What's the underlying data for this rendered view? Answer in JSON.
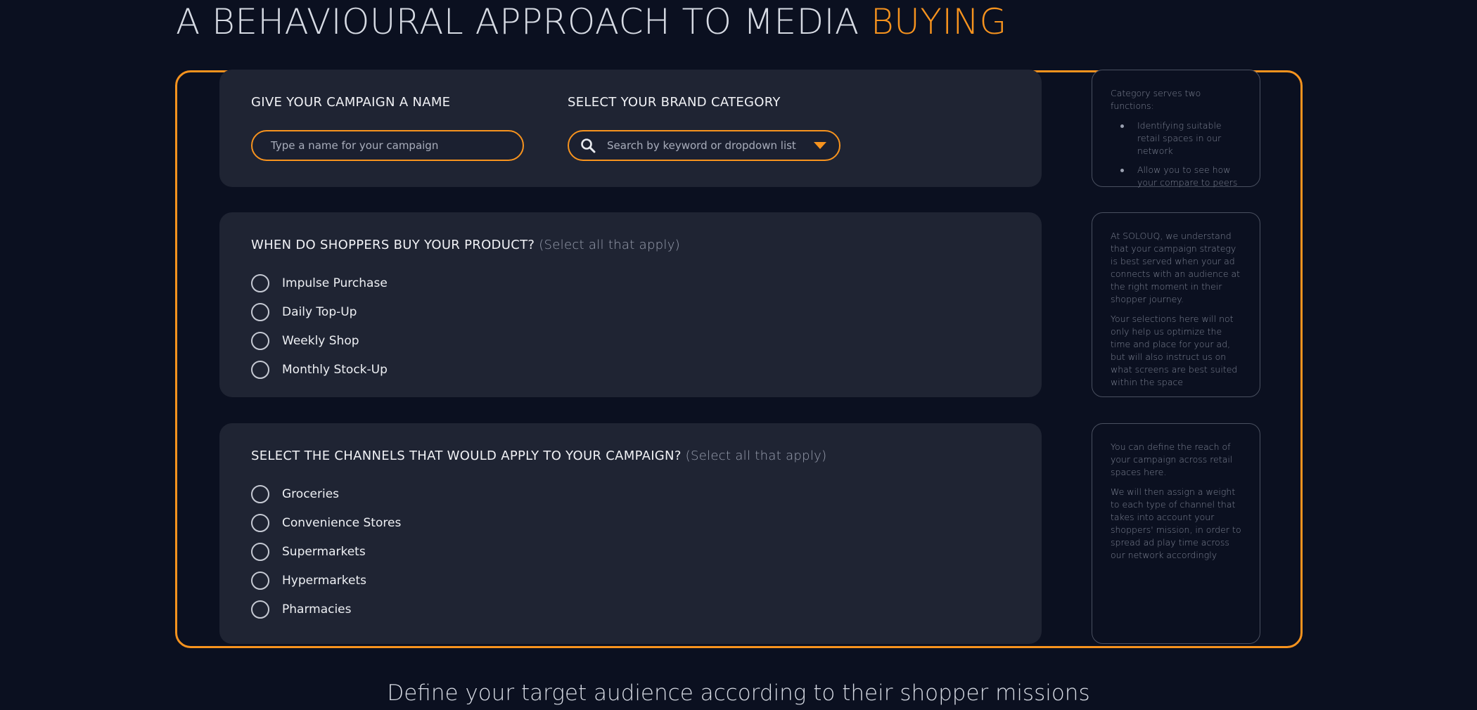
{
  "header": {
    "title_main": "A BEHAVIOURAL APPROACH TO MEDIA ",
    "title_accent": "BUYING"
  },
  "campaign": {
    "name_label": "GIVE YOUR CAMPAIGN A NAME",
    "name_placeholder": "Type a name for your campaign",
    "category_label": "SELECT YOUR BRAND CATEGORY",
    "category_placeholder": "Search by keyword or dropdown list"
  },
  "category_info": {
    "intro": "Category serves two functions:",
    "bullets": [
      "Identifying suitable retail spaces in our network",
      "Allow you to see how your compare to peers"
    ]
  },
  "when_section": {
    "question": "WHEN DO SHOPPERS BUY YOUR PRODUCT?",
    "hint": "(Select all that apply)",
    "options": [
      "Impulse Purchase",
      "Daily Top-Up",
      "Weekly Shop",
      "Monthly Stock-Up"
    ]
  },
  "when_info": {
    "p1": "At SOLOUQ, we understand that your campaign strategy is best served when your ad connects with an audience at the right moment in their shopper journey.",
    "p2": "Your selections here will not only help us optimize the time and place for your ad, but will also instruct us on what screens are best suited within the space"
  },
  "channels_section": {
    "question": "SELECT THE CHANNELS THAT WOULD APPLY TO YOUR CAMPAIGN?",
    "hint": "(Select all that apply)",
    "options": [
      "Groceries",
      "Convenience Stores",
      "Supermarkets",
      "Hypermarkets",
      "Pharmacies"
    ]
  },
  "channels_info": {
    "p1": "You can define the reach of your campaign across retail spaces here.",
    "p2": "We will then assign a weight to each type of channel that takes into account your shoppers' mission, in order to spread  ad play time across our network accordingly"
  },
  "footer": {
    "title": "Define your target audience according to their shopper missions"
  },
  "colors": {
    "accent": "#f7931e",
    "background": "#0b1020",
    "card": "#1f2433"
  }
}
